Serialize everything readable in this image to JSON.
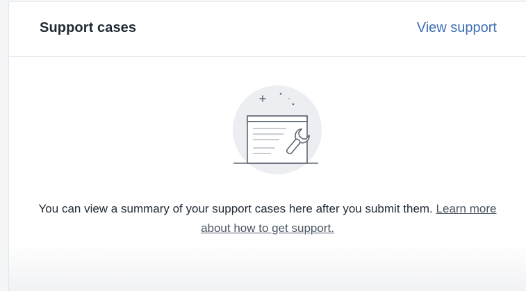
{
  "card": {
    "title": "Support cases",
    "view_link": "View support"
  },
  "empty_state": {
    "icon": "window-wrench-illustration",
    "message": "You can view a summary of your support cases here after you submit them.",
    "learn_link": "Learn more about how to get support."
  },
  "colors": {
    "link": "#3d6eb4",
    "text": "#1f2933",
    "illustration_bg": "#eceef1",
    "illustration_stroke": "#5f6873"
  }
}
